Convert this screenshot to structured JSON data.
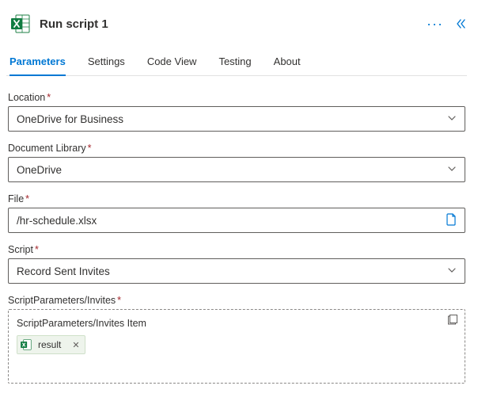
{
  "header": {
    "title": "Run script 1"
  },
  "tabs": {
    "items": [
      {
        "label": "Parameters",
        "active": true
      },
      {
        "label": "Settings",
        "active": false
      },
      {
        "label": "Code View",
        "active": false
      },
      {
        "label": "Testing",
        "active": false
      },
      {
        "label": "About",
        "active": false
      }
    ]
  },
  "fields": {
    "location": {
      "label": "Location",
      "required": true,
      "value": "OneDrive for Business"
    },
    "library": {
      "label": "Document Library",
      "required": true,
      "value": "OneDrive"
    },
    "file": {
      "label": "File",
      "required": true,
      "value": "/hr-schedule.xlsx"
    },
    "script": {
      "label": "Script",
      "required": true,
      "value": "Record Sent Invites"
    },
    "invites": {
      "label": "ScriptParameters/Invites",
      "required": true,
      "item_label": "ScriptParameters/Invites Item",
      "tag": "result"
    }
  }
}
